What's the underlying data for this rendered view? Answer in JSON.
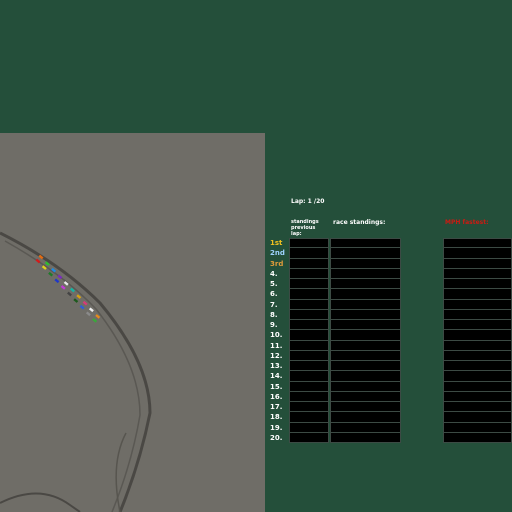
{
  "hud": {
    "lap_label": "Lap: 1 /20",
    "header_previous": "standings previous lap:",
    "header_race": "race standings:",
    "header_mph": "MPH fastest:"
  },
  "standings": {
    "positions": [
      "1st",
      "2nd",
      "3rd",
      "4.",
      "5.",
      "6.",
      "7.",
      "8.",
      "9.",
      "10.",
      "11.",
      "12.",
      "13.",
      "14.",
      "15.",
      "16.",
      "17.",
      "18.",
      "19.",
      "20."
    ]
  },
  "minimap": {
    "car_colors": [
      "#d21b1b",
      "#e36b12",
      "#e0d21c",
      "#2fbf2f",
      "#1f7a2a",
      "#1e8be0",
      "#2038c8",
      "#7a2bbd",
      "#c23ad6",
      "#e8e8e8",
      "#444444",
      "#13b5a4",
      "#1d5a1d",
      "#d7a312",
      "#2e5fd6",
      "#d63a7a",
      "#8a8a8a",
      "#f0f0f0",
      "#3aa83a",
      "#e68a1a"
    ]
  }
}
